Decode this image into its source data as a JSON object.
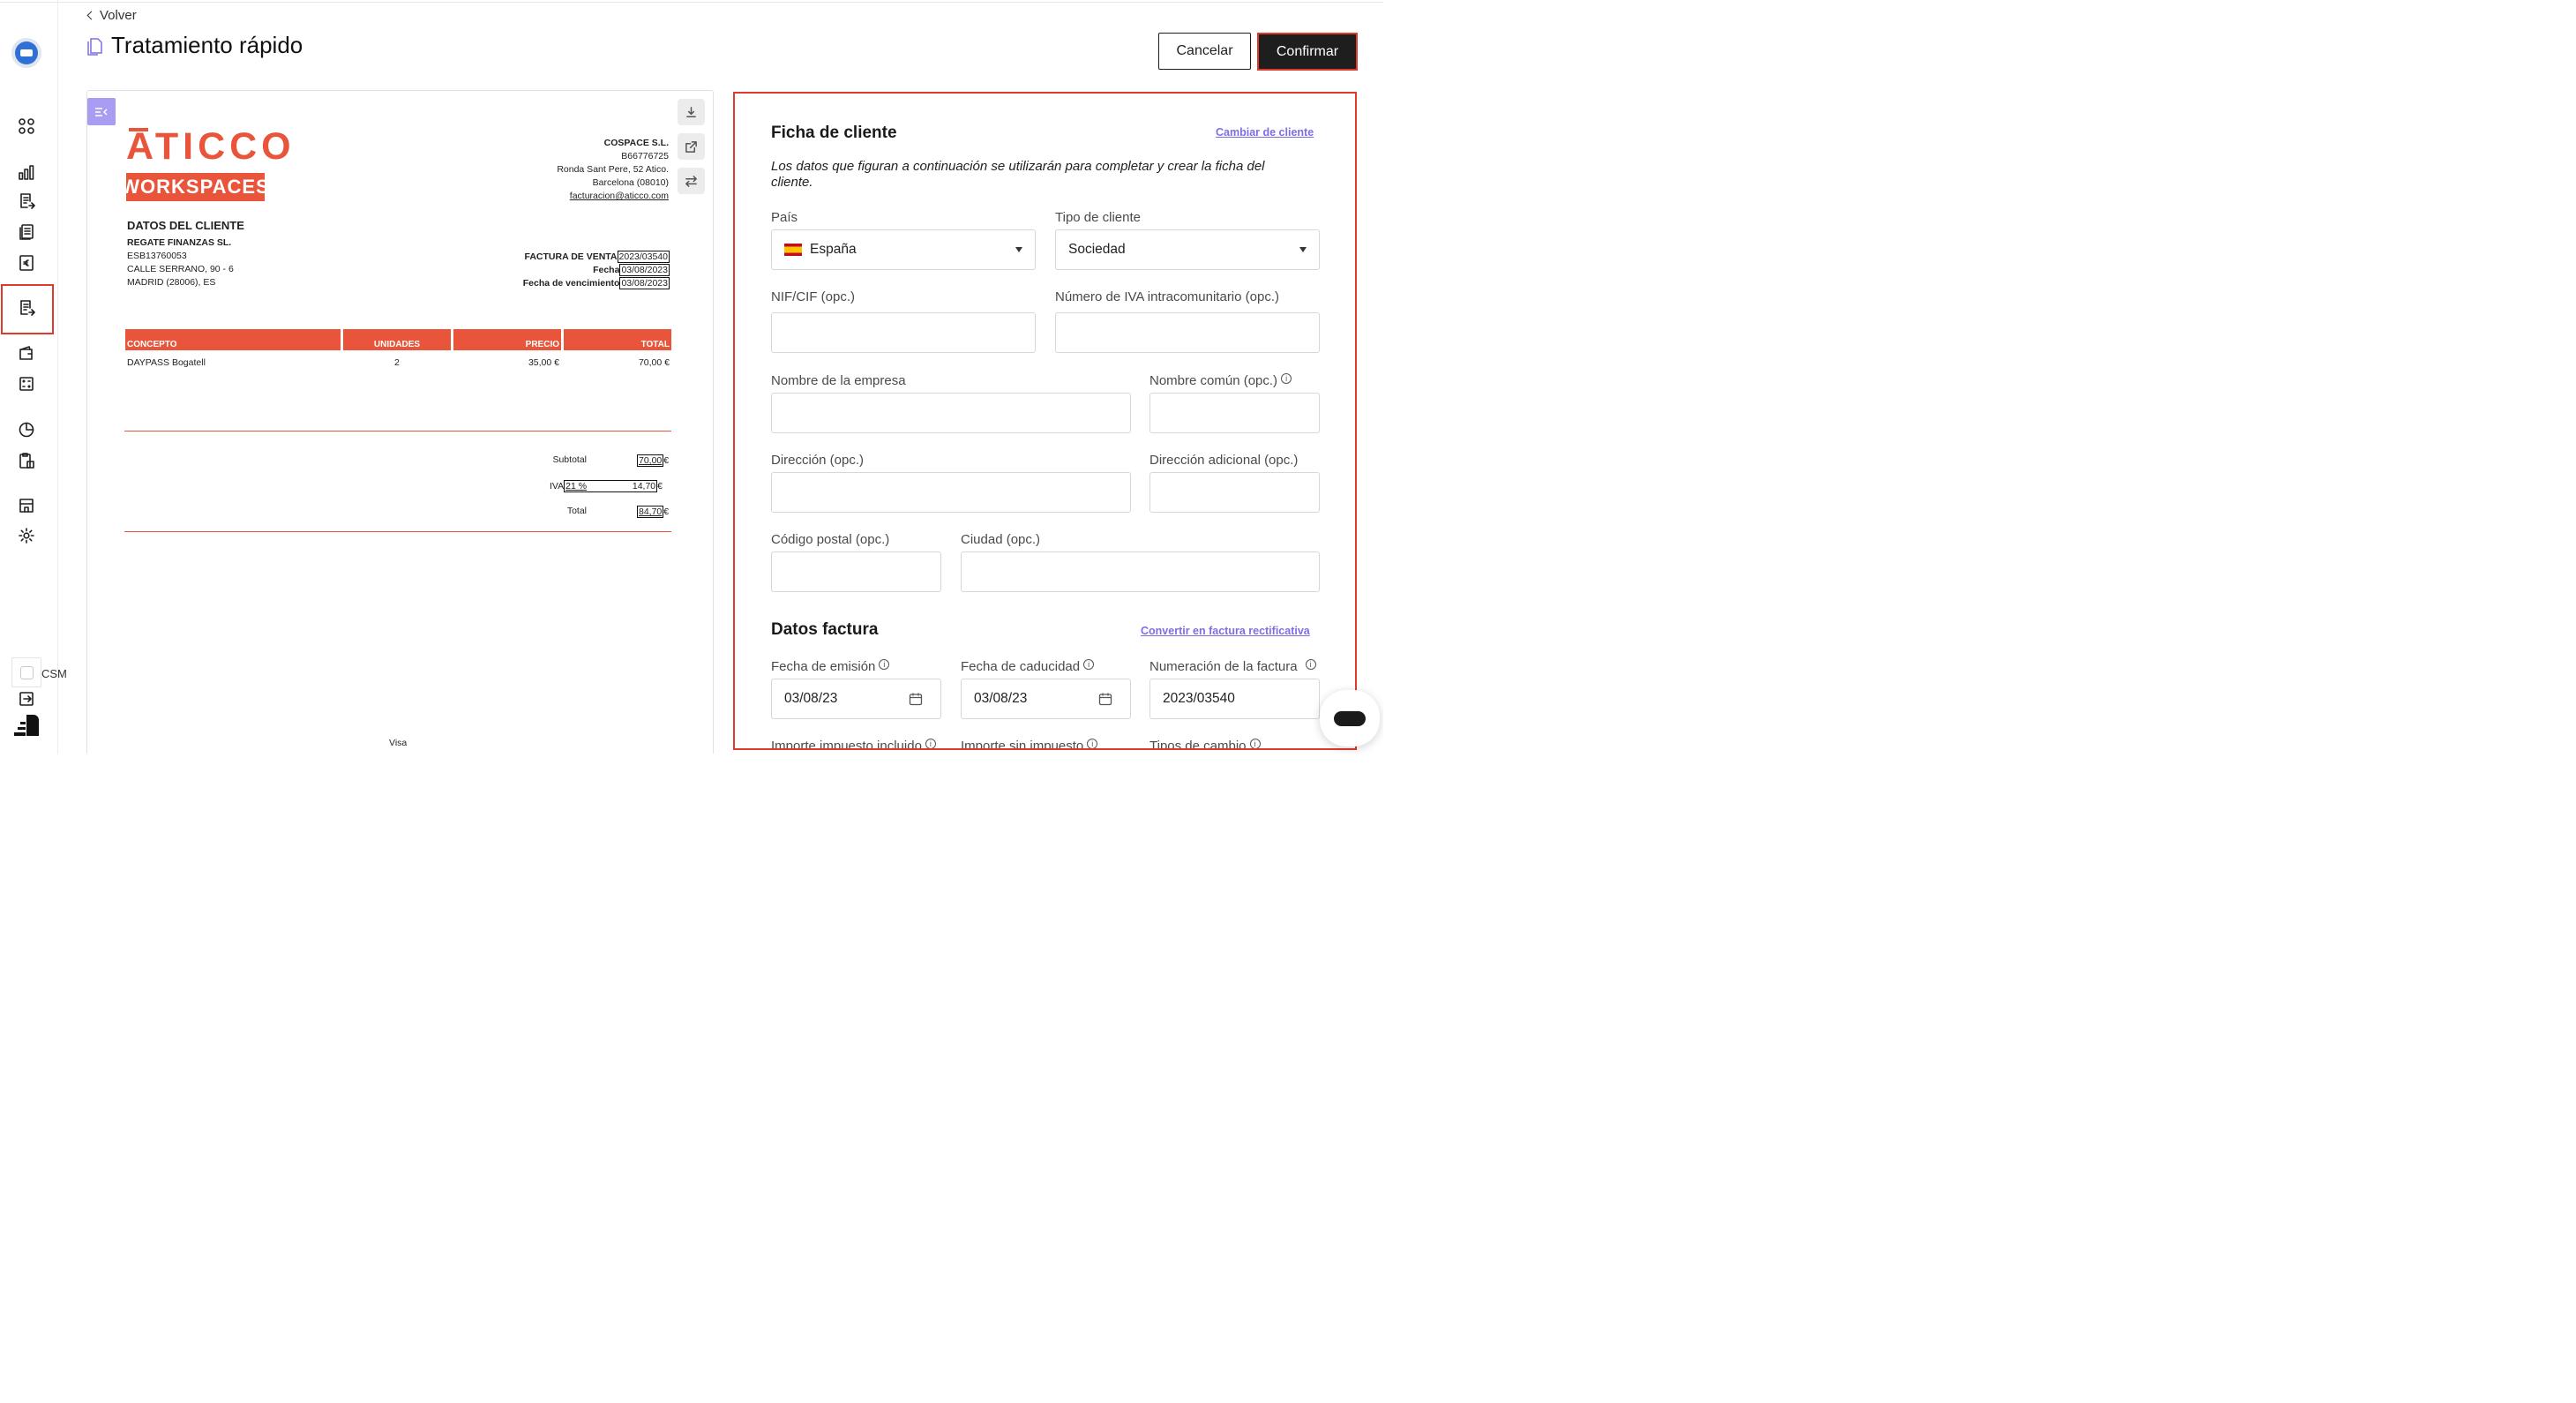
{
  "header": {
    "back_label": "Volver",
    "title": "Tratamiento rápido",
    "cancel_label": "Cancelar",
    "confirm_label": "Confirmar"
  },
  "sidebar": {
    "csm_label": "CSM",
    "icons": [
      "logo-avatar-icon",
      "dashboard-icon",
      "bar-chart-icon",
      "invoice-in-icon",
      "documents-icon",
      "euro-receipt-icon",
      "invoice-out-icon",
      "wallet-icon",
      "calculator-icon",
      "pie-chart-icon",
      "clipboard-icon",
      "store-icon",
      "gear-icon",
      "logout-icon",
      "brand-icon"
    ]
  },
  "invoice": {
    "logo_top": "ATICCO",
    "logo_bottom": "WORKSPACES",
    "issuer": {
      "name": "COSPACE S.L.",
      "tax_id": "B66776725",
      "address": "Ronda Sant Pere, 52 Atico.",
      "city": "Barcelona (08010)",
      "email": "facturacion@aticco.com"
    },
    "client_heading": "DATOS DEL CLIENTE",
    "client": {
      "name": "REGATE FINANZAS SL.",
      "tax_id": "ESB13760053",
      "address": "CALLE SERRANO, 90 - 6",
      "city": "MADRID (28006), ES"
    },
    "meta": {
      "invoice_label": "FACTURA DE VENTA",
      "invoice_value": "2023/03540",
      "date_label": "Fecha",
      "date_value": "03/08/2023",
      "due_label": "Fecha de vencimiento",
      "due_value": "03/08/2023"
    },
    "table": {
      "headers": [
        "CONCEPTO",
        "UNIDADES",
        "PRECIO",
        "TOTAL"
      ],
      "rows": [
        {
          "concept": "DAYPASS Bogatell",
          "units": "2",
          "price": "35,00 €",
          "total": "70,00 €"
        }
      ]
    },
    "totals": {
      "subtotal_label": "Subtotal",
      "subtotal_value": "70,00",
      "iva_label": "IVA",
      "iva_rate": "21 %",
      "iva_value": "14,70",
      "total_label": "Total",
      "total_value": "84,70",
      "currency": "€"
    },
    "footer_text": "Visa"
  },
  "form": {
    "client_section_title": "Ficha de cliente",
    "change_client_link": "Cambiar de cliente",
    "description": "Los datos que figuran a continuación se utilizarán para completar y crear la ficha del cliente.",
    "country_label": "País",
    "country_value": "España",
    "client_type_label": "Tipo de cliente",
    "client_type_value": "Sociedad",
    "nif_label": "NIF/CIF (opc.)",
    "vat_label": "Número de IVA intracomunitario (opc.)",
    "company_name_label": "Nombre de la empresa",
    "common_name_label": "Nombre común (opc.)",
    "address_label": "Dirección (opc.)",
    "address2_label": "Dirección adicional (opc.)",
    "postal_code_label": "Código postal (opc.)",
    "city_label": "Ciudad (opc.)",
    "invoice_section_title": "Datos factura",
    "rectify_link": "Convertir en factura rectificativa",
    "issue_date_label": "Fecha de emisión",
    "issue_date_value": "03/08/23",
    "due_date_label": "Fecha de caducidad",
    "due_date_value": "03/08/23",
    "invoice_number_label": "Numeración de la factura",
    "invoice_number_value": "2023/03540",
    "amount_incl_label": "Importe impuesto incluido",
    "amount_excl_label": "Importe sin impuesto",
    "exchange_label": "Tipos de cambio"
  },
  "colors": {
    "accent_red": "#e03a2f",
    "brand_orange": "#e8553a",
    "link_purple": "#7d6ee6",
    "dark": "#1e1e1e"
  }
}
